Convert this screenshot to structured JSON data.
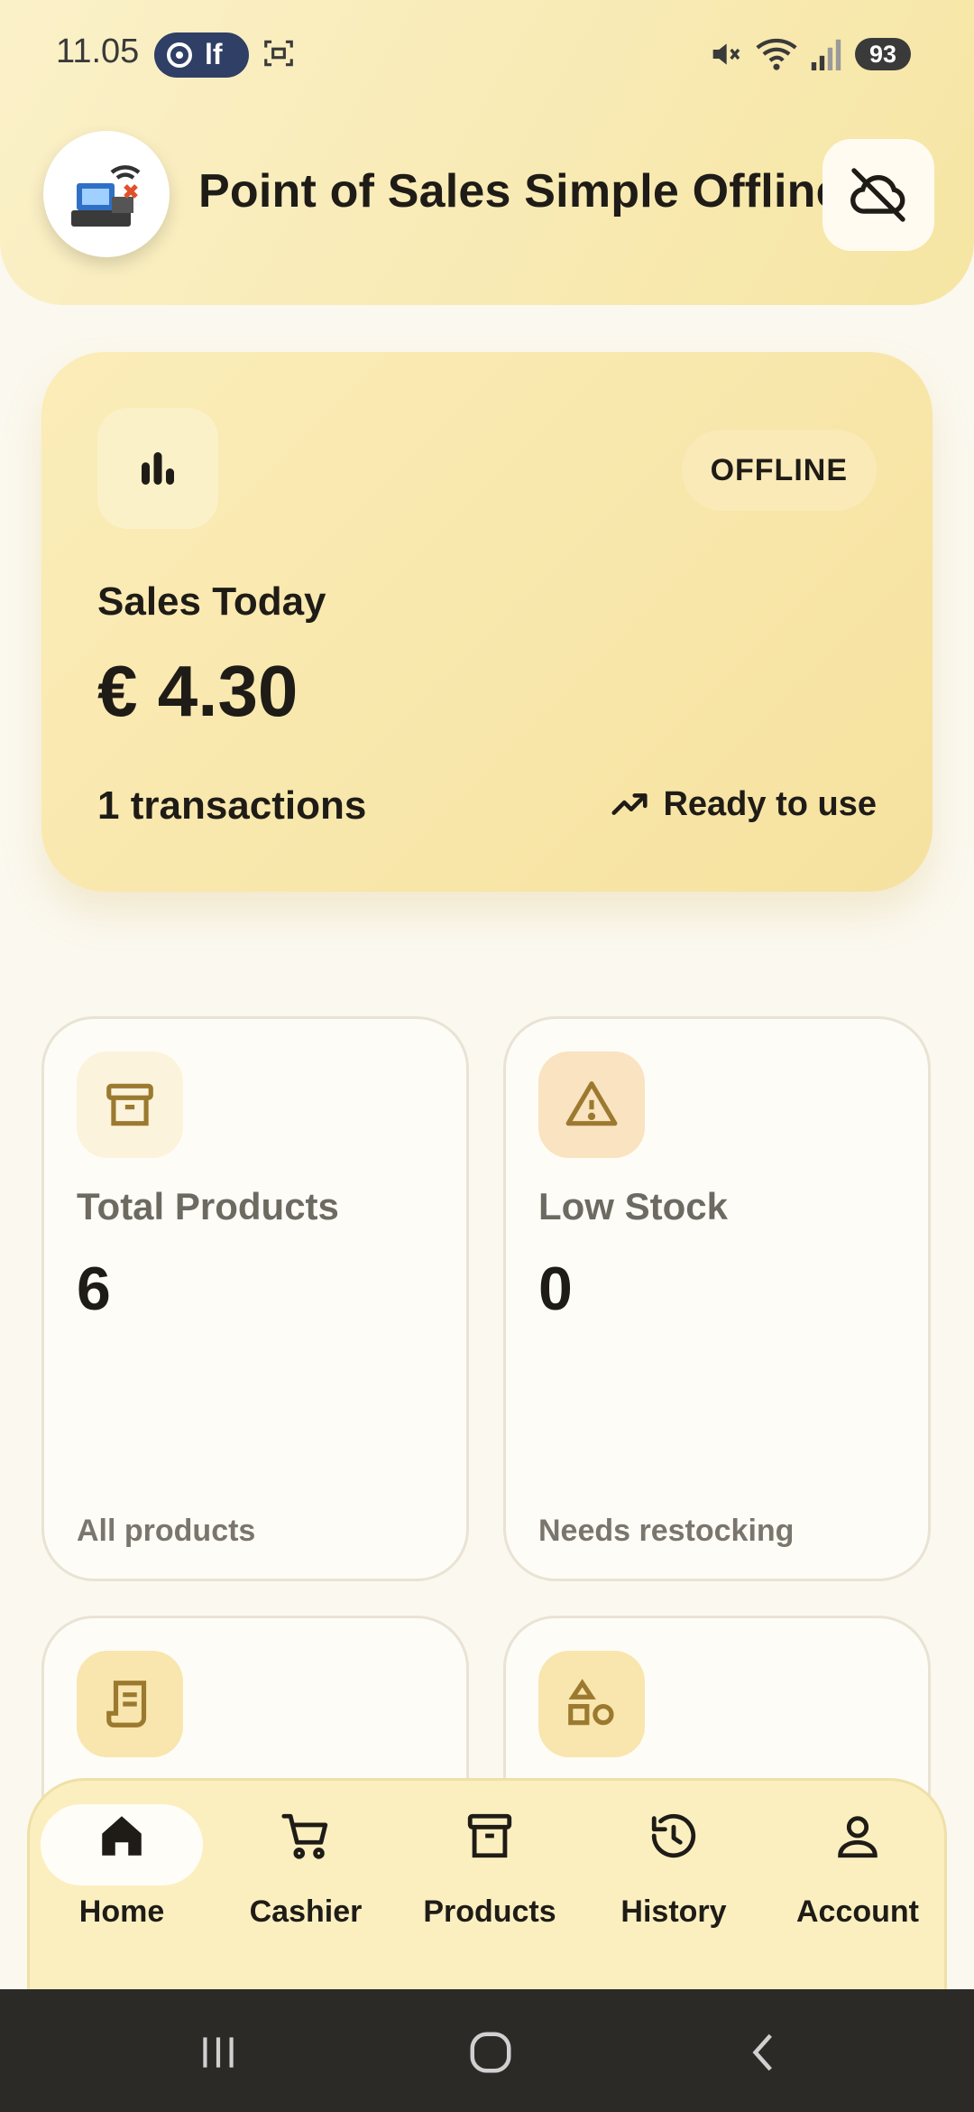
{
  "status": {
    "time": "11.05",
    "pill_text": "lf",
    "battery": "93"
  },
  "header": {
    "title": "Point of Sales Simple Offline"
  },
  "sales_card": {
    "badge": "OFFLINE",
    "label": "Sales Today",
    "value": "€ 4.30",
    "transactions": "1 transactions",
    "ready": "Ready to use"
  },
  "stats": [
    {
      "label": "Total Products",
      "value": "6",
      "sub": "All products",
      "icon": "archive-icon"
    },
    {
      "label": "Low Stock",
      "value": "0",
      "sub": "Needs restocking",
      "icon": "warning-icon"
    }
  ],
  "nav": {
    "items": [
      {
        "label": "Home",
        "icon": "home-icon"
      },
      {
        "label": "Cashier",
        "icon": "cart-icon"
      },
      {
        "label": "Products",
        "icon": "archive-icon"
      },
      {
        "label": "History",
        "icon": "history-icon"
      },
      {
        "label": "Account",
        "icon": "person-icon"
      }
    ],
    "active_index": 0
  },
  "colors": {
    "accent": "#f6e29f",
    "icon_brown": "#9b7a30",
    "warning_bg": "#f9e3c0"
  }
}
